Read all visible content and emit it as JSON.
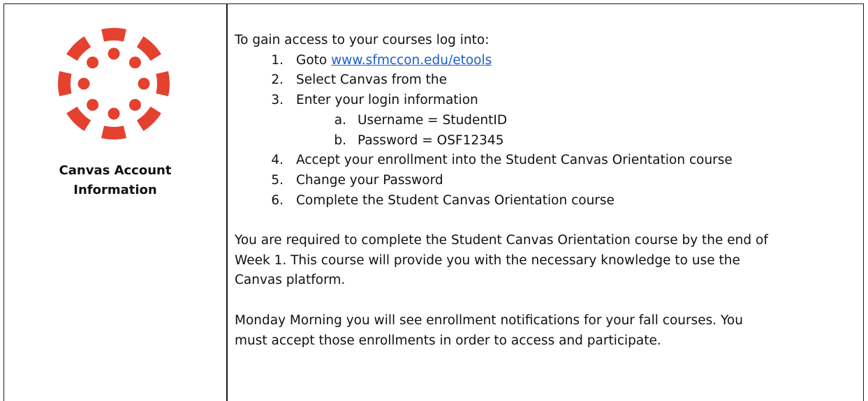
{
  "logo": {
    "icon": "canvas-logo-icon",
    "color": "#e4412f"
  },
  "left": {
    "title_line1": "Canvas Account",
    "title_line2": "Information"
  },
  "right": {
    "intro": "To gain access to your courses log into:",
    "steps": [
      {
        "num": "1.",
        "text": "Goto ",
        "link": "www.sfmccon.edu/etools"
      },
      {
        "num": "2.",
        "text": "Select Canvas from the"
      },
      {
        "num": "3.",
        "text": "Enter your login information"
      },
      {
        "num": "4.",
        "text": "Accept your enrollment into the Student Canvas Orientation course"
      },
      {
        "num": "5.",
        "text": "Change your Password"
      },
      {
        "num": "6.",
        "text": "Complete the Student Canvas Orientation course"
      }
    ],
    "substeps": [
      {
        "num": "a.",
        "text": "Username = StudentID"
      },
      {
        "num": "b.",
        "text": "Password = OSF12345"
      }
    ],
    "paragraph1_line1": "You are required to complete the Student Canvas Orientation course by the end of",
    "paragraph1_line2": "Week 1. This course will provide you with the necessary knowledge to use the",
    "paragraph1_line3": "Canvas platform.",
    "paragraph2_line1": "Monday Morning you will see enrollment notifications for your fall courses. You",
    "paragraph2_line2": "must accept those enrollments in order to access and participate."
  }
}
